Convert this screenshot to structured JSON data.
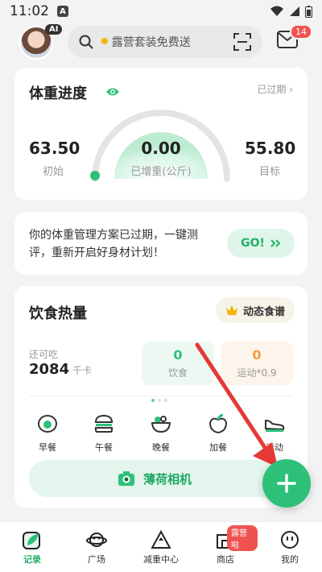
{
  "status_bar": {
    "time": "11:02",
    "notif_letter": "A"
  },
  "header": {
    "ai_badge": "AI",
    "search_placeholder": "露营套装免费送",
    "mail_badge": "14"
  },
  "weight_card": {
    "title": "体重进度",
    "status": "已过期",
    "start_value": "63.50",
    "start_label": "初始",
    "gained_value": "0.00",
    "gained_label": "已增重(公斤)",
    "target_value": "55.80",
    "target_label": "目标",
    "progress": 0
  },
  "plan_card": {
    "message": "你的体重管理方案已过期，一键测评，重新开启好身材计划！",
    "button": "GO!"
  },
  "diet_card": {
    "title": "饮食热量",
    "recipe_button": "动态食谱",
    "remaining_label": "还可吃",
    "remaining_value": "2084",
    "remaining_unit": "千卡",
    "intake_value": "0",
    "intake_label": "饮食",
    "exercise_value": "0",
    "exercise_label": "运动*0.9",
    "meals": [
      {
        "label": "早餐",
        "icon": "egg-icon"
      },
      {
        "label": "午餐",
        "icon": "burger-icon"
      },
      {
        "label": "晚餐",
        "icon": "bowl-icon"
      },
      {
        "label": "加餐",
        "icon": "apple-icon"
      },
      {
        "label": "运动",
        "icon": "shoe-icon"
      }
    ],
    "camera_button": "薄荷相机"
  },
  "bottom_nav": {
    "items": [
      {
        "label": "记录",
        "icon": "leaf-icon",
        "active": true
      },
      {
        "label": "广场",
        "icon": "planet-icon"
      },
      {
        "label": "减重中心",
        "icon": "triangle-icon"
      },
      {
        "label": "商店",
        "icon": "store-icon",
        "badge": "露营啦"
      },
      {
        "label": "我的",
        "icon": "face-icon"
      }
    ]
  },
  "colors": {
    "accent": "#2dc078",
    "badge": "#ef5350",
    "annotation_arrow": "#e53935"
  }
}
